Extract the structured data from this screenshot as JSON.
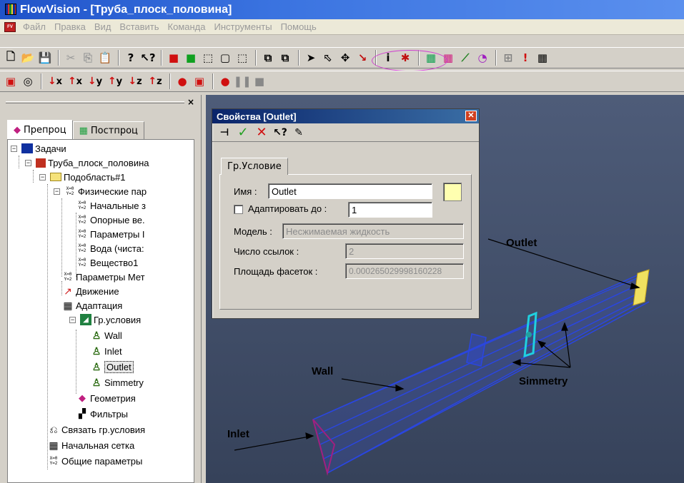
{
  "window": {
    "title": "FlowVision - [Труба_плоск_половина]"
  },
  "menu": {
    "items": [
      "Файл",
      "Правка",
      "Вид",
      "Вставить",
      "Команда",
      "Инструменты",
      "Помощь"
    ]
  },
  "toolbar": {
    "axis_buttons": [
      "x",
      "x",
      "y",
      "y",
      "z",
      "z"
    ]
  },
  "left_panel": {
    "tabs": [
      "Препроц",
      "Постпроц"
    ],
    "tree": [
      "Задачи",
      "Труба_плоск_половина",
      "Подобласть#1",
      "Физические пар",
      "Начальные з",
      "Опорные ве.",
      "Параметры I",
      "Вода (чиста:",
      "Вещество1",
      "Параметры Мет",
      "Движение",
      "Адаптация",
      "Гр.условия",
      "Wall",
      "Inlet",
      "Outlet",
      "Simmetry",
      "Геометрия",
      "Фильтры",
      "Связать гр.условия",
      "Начальная сетка",
      "Общие параметры"
    ]
  },
  "dialog": {
    "title": "Свойства [Outlet]",
    "tab": "Гр.Условие",
    "name_label": "Имя :",
    "name_value": "Outlet",
    "adapt_label": "Адаптировать до :",
    "adapt_value": "1",
    "model_label": "Модель :",
    "model_value": "Несжимаемая жидкость",
    "links_label": "Число ссылок :",
    "links_value": "2",
    "area_label": "Площадь фасеток :",
    "area_value": "0.000265029998160228",
    "swatch_color": "#ffffb0"
  },
  "viewport": {
    "labels": {
      "outlet": "Outlet",
      "wall": "Wall",
      "simmetry": "Simmetry",
      "inlet": "Inlet"
    },
    "colors": {
      "background": "#46536e",
      "mesh": "#2a46e0",
      "outlet_face": "#f0e060",
      "inlet_face": "#a02080",
      "symmetry_face": "#20d0e0"
    }
  }
}
